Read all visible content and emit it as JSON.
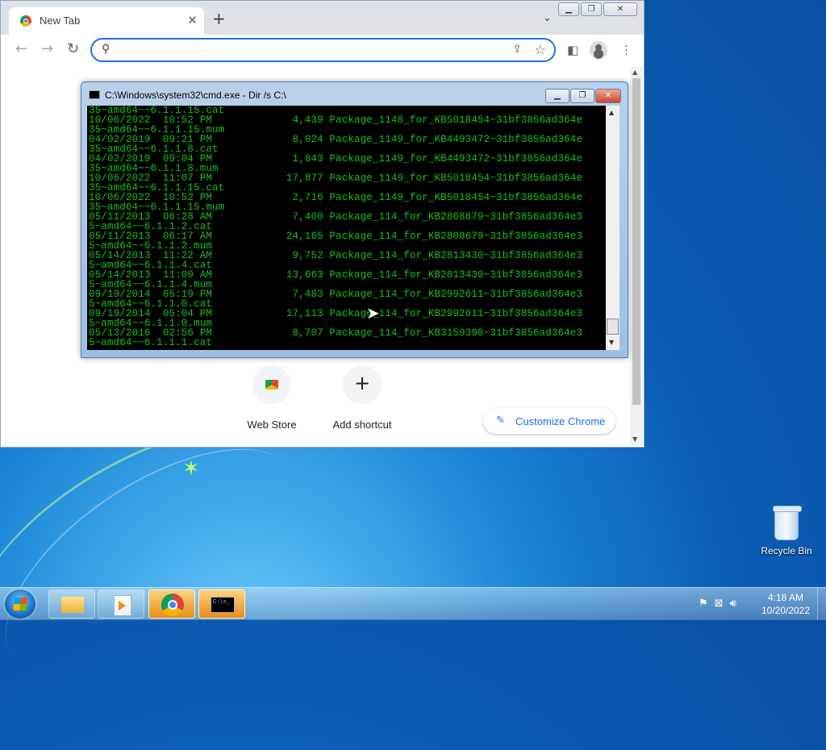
{
  "browser": {
    "tab_title": "New Tab",
    "omnibox_value": "",
    "shortcuts": [
      {
        "label": "Web Store"
      },
      {
        "label": "Add shortcut"
      }
    ],
    "customize_label": "Customize Chrome"
  },
  "cmd": {
    "title": "C:\\Windows\\system32\\cmd.exe - Dir /s C:\\",
    "lines": [
      "35~amd64~~6.1.1.15.cat",
      "10/06/2022  10:52 PM             4,439 Package_1148_for_KB5018454~31bf3856ad364e",
      "35~amd64~~6.1.1.15.mum",
      "04/02/2019  09:21 PM             8,024 Package_1149_for_KB4493472~31bf3856ad364e",
      "35~amd64~~6.1.1.8.cat",
      "04/02/2019  09:04 PM             1,843 Package_1149_for_KB4493472~31bf3856ad364e",
      "35~amd64~~6.1.1.8.mum",
      "10/06/2022  11:07 PM            17,877 Package_1149_for_KB5018454~31bf3856ad364e",
      "35~amd64~~6.1.1.15.cat",
      "10/06/2022  10:52 PM             2,716 Package_1149_for_KB5018454~31bf3856ad364e",
      "35~amd64~~6.1.1.15.mum",
      "05/11/2013  06:28 AM             7,400 Package_114_for_KB2808679~31bf3856ad364e3",
      "5~amd64~~6.1.1.2.cat",
      "05/11/2013  06:17 AM            24,165 Package_114_for_KB2808679~31bf3856ad364e3",
      "5~amd64~~6.1.1.2.mum",
      "05/14/2013  11:22 AM             9,752 Package_114_for_KB2813430~31bf3856ad364e3",
      "5~amd64~~6.1.1.4.cat",
      "05/14/2013  11:09 AM            13,663 Package_114_for_KB2813430~31bf3856ad364e3",
      "5~amd64~~6.1.1.4.mum",
      "09/19/2014  05:19 PM             7,483 Package_114_for_KB2992611~31bf3856ad364e3",
      "5~amd64~~6.1.1.0.cat",
      "09/19/2014  05:04 PM            17,113 Package_114_for_KB2992611~31bf3856ad364e3",
      "5~amd64~~6.1.1.0.mum",
      "05/13/2016  02:56 PM             8,707 Package_114_for_KB3159398~31bf3856ad364e3",
      "5~amd64~~6.1.1.1.cat"
    ],
    "text_color": "#17c217"
  },
  "desktop": {
    "recycle_bin_label": "Recycle Bin"
  },
  "taskbar": {
    "apps": [
      "windows-explorer",
      "media-player",
      "google-chrome",
      "command-prompt"
    ],
    "cmd_glyph": "C:\\>_",
    "time": "4:18 AM",
    "date": "10/20/2022"
  },
  "colors": {
    "accent": "#1a73e8",
    "console_bg": "#000000",
    "console_fg": "#17c217"
  }
}
